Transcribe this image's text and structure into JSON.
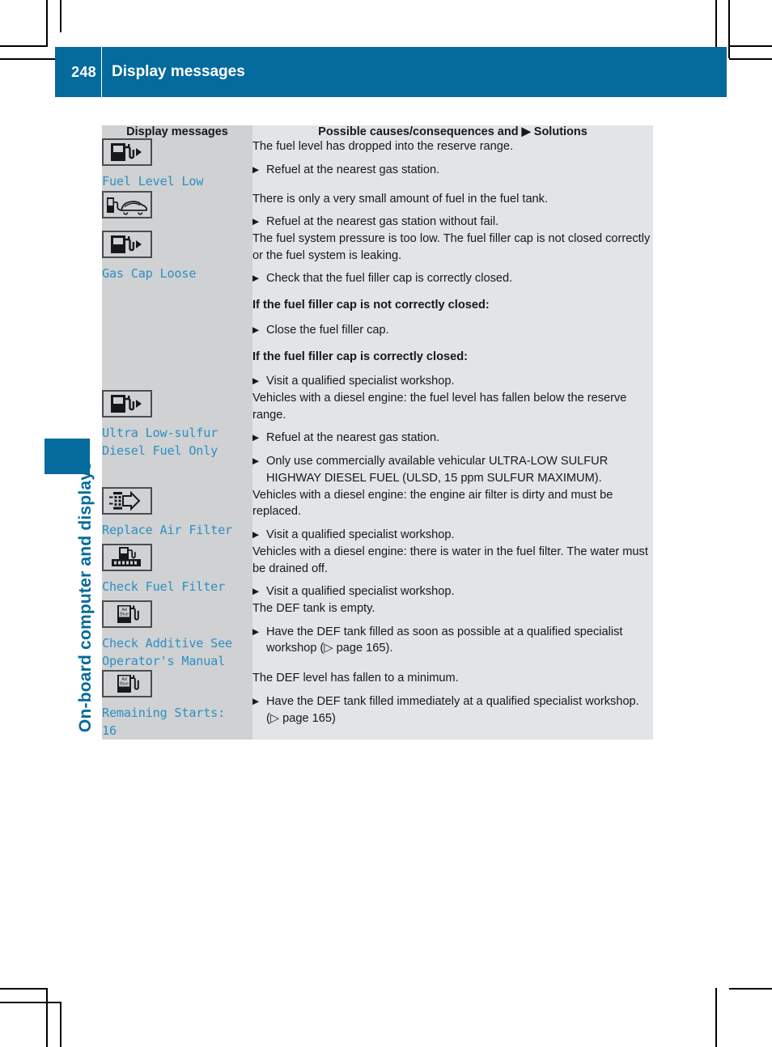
{
  "page": {
    "number": "248",
    "header_title": "Display messages",
    "chapter_label": "On-board computer and displays",
    "accent_color": "#056a9c",
    "message_text_color": "#2d8fc4"
  },
  "table": {
    "headers": {
      "left": "Display messages",
      "right": "Possible causes/consequences and ▶ Solutions"
    },
    "rows": [
      {
        "icon": "fuel-pump-arrow-icon",
        "message": "Fuel Level Low",
        "content": [
          {
            "type": "para",
            "text": "The fuel level has dropped into the reserve range."
          },
          {
            "type": "bullet",
            "text": "Refuel at the nearest gas station."
          }
        ]
      },
      {
        "icon": "fuel-pump-car-icon",
        "message": "",
        "content": [
          {
            "type": "para",
            "text": "There is only a very small amount of fuel in the fuel tank."
          },
          {
            "type": "bullet",
            "text": "Refuel at the nearest gas station without fail."
          }
        ]
      },
      {
        "icon": "fuel-pump-arrow-icon",
        "message": "Gas Cap Loose",
        "content": [
          {
            "type": "para",
            "text": "The fuel system pressure is too low. The fuel filler cap is not closed correctly or the fuel system is leaking."
          },
          {
            "type": "bullet",
            "text": "Check that the fuel filler cap is correctly closed."
          },
          {
            "type": "para-bold",
            "text": "If the fuel filler cap is not correctly closed:"
          },
          {
            "type": "bullet",
            "text": "Close the fuel filler cap."
          },
          {
            "type": "para-bold",
            "text": "If the fuel filler cap is correctly closed:"
          },
          {
            "type": "bullet",
            "text": "Visit a qualified specialist workshop."
          }
        ]
      },
      {
        "icon": "fuel-pump-arrow-icon",
        "message": "Ultra Low-sulfur\nDiesel Fuel Only",
        "content": [
          {
            "type": "para",
            "text": "Vehicles with a diesel engine: the fuel level has fallen below the reserve range."
          },
          {
            "type": "bullet",
            "text": "Refuel at the nearest gas station."
          },
          {
            "type": "bullet",
            "text": "Only use commercially available vehicular ULTRA-LOW SULFUR HIGHWAY DIESEL FUEL (ULSD, 15 ppm SULFUR MAXIMUM)."
          }
        ]
      },
      {
        "icon": "air-filter-arrow-icon",
        "message": "Replace Air Filter",
        "content": [
          {
            "type": "para",
            "text": "Vehicles with a diesel engine: the engine air filter is dirty and must be replaced."
          },
          {
            "type": "bullet",
            "text": "Visit a qualified specialist workshop."
          }
        ]
      },
      {
        "icon": "fuel-filter-icon",
        "message": "Check Fuel Filter",
        "content": [
          {
            "type": "para",
            "text": "Vehicles with a diesel engine: there is water in the fuel filter. The water must be drained off."
          },
          {
            "type": "bullet",
            "text": "Visit a qualified specialist workshop."
          }
        ]
      },
      {
        "icon": "adblue-pump-icon",
        "message": "Check Additive See\nOperator's Manual",
        "content": [
          {
            "type": "para",
            "text": "The DEF tank is empty."
          },
          {
            "type": "bullet",
            "text": "Have the DEF tank filled as soon as possible at a qualified specialist workshop (▷ page 165)."
          }
        ]
      },
      {
        "icon": "adblue-pump-icon",
        "message": "Remaining Starts:\n16",
        "content": [
          {
            "type": "para",
            "text": "The DEF level has fallen to a minimum."
          },
          {
            "type": "bullet",
            "text": "Have the DEF tank filled immediately at a qualified specialist workshop. (▷ page 165)"
          }
        ]
      }
    ]
  }
}
